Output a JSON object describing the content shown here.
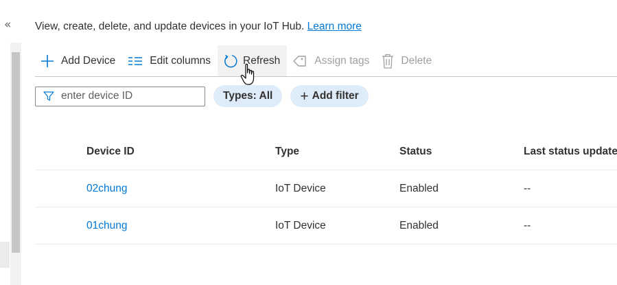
{
  "rail": {
    "collapse_glyph": "«"
  },
  "intro": {
    "text": "View, create, delete, and update devices in your IoT Hub.",
    "link": "Learn more"
  },
  "toolbar": {
    "add_device": "Add Device",
    "edit_columns": "Edit columns",
    "refresh": "Refresh",
    "assign_tags": "Assign tags",
    "delete": "Delete"
  },
  "filter": {
    "placeholder": "enter device ID",
    "types_pill": "Types: All",
    "add_filter": "Add filter"
  },
  "grid": {
    "columns": [
      "Device ID",
      "Type",
      "Status",
      "Last status update"
    ],
    "rows": [
      {
        "device_id": "02chung",
        "type": "IoT Device",
        "status": "Enabled",
        "last_update": "--"
      },
      {
        "device_id": "01chung",
        "type": "IoT Device",
        "status": "Enabled",
        "last_update": "--"
      }
    ]
  },
  "colors": {
    "accent": "#0078d4",
    "pill_bg": "#deecf9",
    "disabled_text": "#a19f9d"
  }
}
